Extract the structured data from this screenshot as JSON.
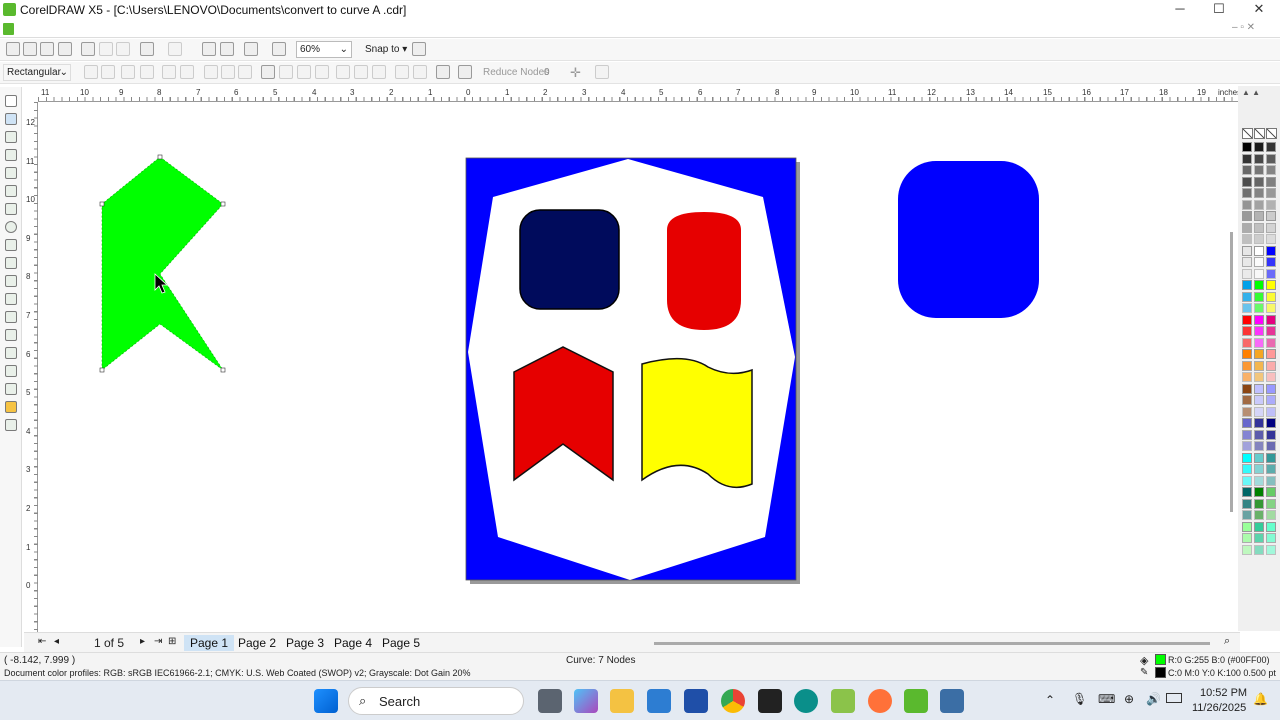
{
  "app": {
    "title": "CorelDRAW X5 - [C:\\Users\\LENOVO\\Documents\\convert to curve A .cdr]"
  },
  "window_controls": {
    "minimize": "─",
    "maximize": "☐",
    "close": "✕"
  },
  "toolbar": {
    "zoom": "60%",
    "snap_to": "Snap to"
  },
  "property_bar": {
    "node_type": "Rectangular",
    "reduce_nodes": "Reduce Nodes",
    "reduce_value": "0"
  },
  "ruler": {
    "units": "inches",
    "h_ticks": [
      "11",
      "10",
      "9",
      "8",
      "7",
      "6",
      "5",
      "4",
      "3",
      "2",
      "1",
      "0",
      "1",
      "2",
      "3",
      "4",
      "5",
      "6",
      "7",
      "8",
      "9",
      "10",
      "11",
      "12",
      "13",
      "14",
      "15",
      "16",
      "17",
      "18",
      "19"
    ],
    "v_ticks": [
      "12",
      "11",
      "10",
      "9",
      "8",
      "7",
      "6",
      "5",
      "4",
      "3",
      "2",
      "1",
      "0"
    ]
  },
  "pages": {
    "counter": "1 of 5",
    "tabs": [
      "Page 1",
      "Page 2",
      "Page 3",
      "Page 4",
      "Page 5"
    ],
    "active": 0
  },
  "status": {
    "coords": "( -8.142, 7.999 )",
    "object_info": "Curve: 7 Nodes",
    "color_profiles": "Document color profiles: RGB: sRGB IEC61966-2.1; CMYK: U.S. Web Coated (SWOP) v2; Grayscale: Dot Gain 20%",
    "fill": "R:0 G:255 B:0 (#00FF00)",
    "outline": "C:0 M:0 Y:0 K:100  0.500 pt"
  },
  "taskbar": {
    "search": "Search",
    "time": "10:52 PM",
    "date": "11/26/2025"
  },
  "colors": {
    "green": "#00ff00",
    "blue": "#0000ff",
    "navy": "#000b5c",
    "red": "#e60000",
    "yellow": "#ffff00"
  },
  "palette": [
    "#000000",
    "#1a1a1a",
    "#333333",
    "#4d4d4d",
    "#666666",
    "#808080",
    "#999999",
    "#b3b3b3",
    "#cccccc",
    "#e6e6e6",
    "#ffffff",
    "#0000ff",
    "#00a0e9",
    "#00ff00",
    "#ffff00",
    "#ff0000",
    "#ff00ff",
    "#e4007f",
    "#ff8000",
    "#f5a623",
    "#ff9999",
    "#8b4513",
    "#c0c0ff",
    "#9999ff",
    "#6666cc",
    "#333399",
    "#000080",
    "#00ffff",
    "#66cccc",
    "#339999",
    "#006666",
    "#008000",
    "#66cc66",
    "#99ff99",
    "#33cc99",
    "#66ffcc"
  ]
}
